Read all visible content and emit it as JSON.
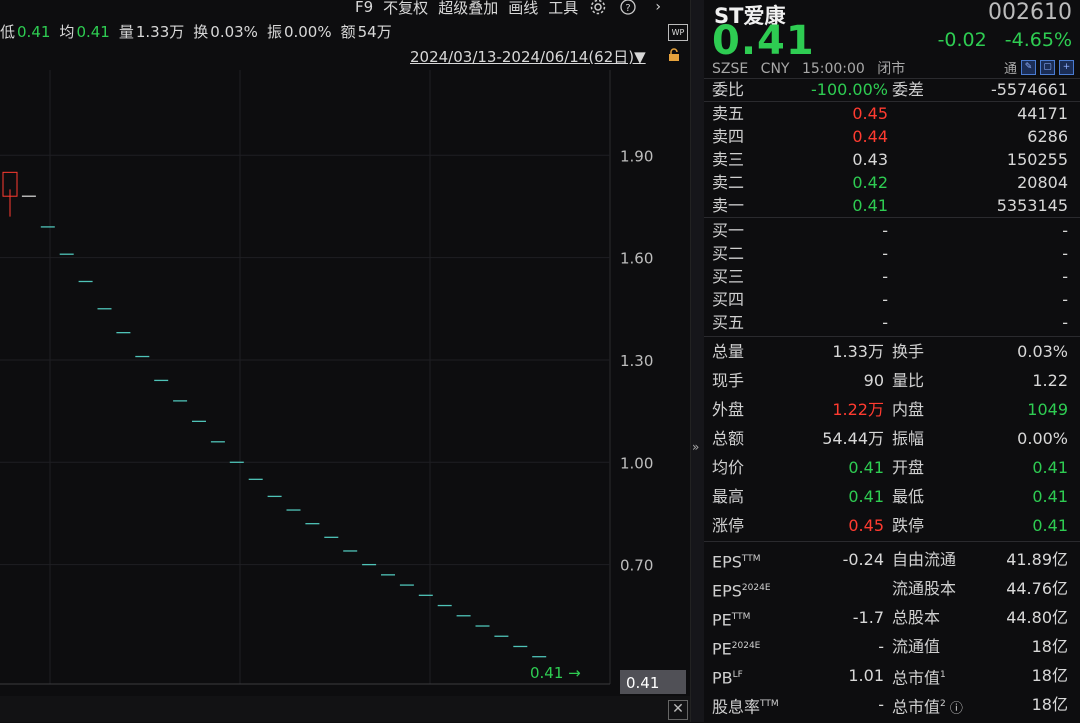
{
  "toolbar": {
    "items": [
      "F9",
      "不复权",
      "超级叠加",
      "画线",
      "工具"
    ],
    "settings_icon": "gear-icon",
    "help_icon": "help-icon",
    "next_icon": "chevron-right-icon"
  },
  "stats": [
    {
      "label": "低",
      "value": "0.41",
      "color": "green"
    },
    {
      "label": "均",
      "value": "0.41",
      "color": "green"
    },
    {
      "label": "量",
      "value": "1.33万",
      "color": "white"
    },
    {
      "label": "换",
      "value": "0.03%",
      "color": "white"
    },
    {
      "label": "振",
      "value": "0.00%",
      "color": "white"
    },
    {
      "label": "额",
      "value": "54万",
      "color": "white"
    }
  ],
  "date_range": "2024/03/13-2024/06/14(62日)▼",
  "wp_label": "WP",
  "chart_data": {
    "type": "candlestick",
    "y_ticks": [
      "1.90",
      "1.60",
      "1.30",
      "1.00",
      "0.70"
    ],
    "ylim": [
      0.35,
      2.15
    ],
    "last_price_label": "0.41",
    "last_price_axis_label": "0.41",
    "candles": [
      {
        "o": 1.85,
        "c": 1.78,
        "h": 1.8,
        "l": 1.72,
        "color": "red"
      },
      {
        "o": 1.78,
        "c": 1.78,
        "h": 1.78,
        "l": 1.78,
        "color": "white"
      },
      {
        "o": 1.69,
        "c": 1.69,
        "h": 1.69,
        "l": 1.69,
        "color": "green"
      },
      {
        "o": 1.61,
        "c": 1.61,
        "h": 1.61,
        "l": 1.61,
        "color": "green"
      },
      {
        "o": 1.53,
        "c": 1.53,
        "h": 1.53,
        "l": 1.53,
        "color": "green"
      },
      {
        "o": 1.45,
        "c": 1.45,
        "h": 1.45,
        "l": 1.45,
        "color": "green"
      },
      {
        "o": 1.38,
        "c": 1.38,
        "h": 1.38,
        "l": 1.38,
        "color": "green"
      },
      {
        "o": 1.31,
        "c": 1.31,
        "h": 1.31,
        "l": 1.31,
        "color": "green"
      },
      {
        "o": 1.24,
        "c": 1.24,
        "h": 1.24,
        "l": 1.24,
        "color": "green"
      },
      {
        "o": 1.18,
        "c": 1.18,
        "h": 1.18,
        "l": 1.18,
        "color": "green"
      },
      {
        "o": 1.12,
        "c": 1.12,
        "h": 1.12,
        "l": 1.12,
        "color": "green"
      },
      {
        "o": 1.06,
        "c": 1.06,
        "h": 1.06,
        "l": 1.06,
        "color": "green"
      },
      {
        "o": 1.0,
        "c": 1.0,
        "h": 1.0,
        "l": 1.0,
        "color": "green"
      },
      {
        "o": 0.95,
        "c": 0.95,
        "h": 0.95,
        "l": 0.95,
        "color": "green"
      },
      {
        "o": 0.9,
        "c": 0.9,
        "h": 0.9,
        "l": 0.9,
        "color": "green"
      },
      {
        "o": 0.86,
        "c": 0.86,
        "h": 0.86,
        "l": 0.86,
        "color": "green"
      },
      {
        "o": 0.82,
        "c": 0.82,
        "h": 0.82,
        "l": 0.82,
        "color": "green"
      },
      {
        "o": 0.78,
        "c": 0.78,
        "h": 0.78,
        "l": 0.78,
        "color": "green"
      },
      {
        "o": 0.74,
        "c": 0.74,
        "h": 0.74,
        "l": 0.74,
        "color": "green"
      },
      {
        "o": 0.7,
        "c": 0.7,
        "h": 0.7,
        "l": 0.7,
        "color": "green"
      },
      {
        "o": 0.67,
        "c": 0.67,
        "h": 0.67,
        "l": 0.67,
        "color": "green"
      },
      {
        "o": 0.64,
        "c": 0.64,
        "h": 0.64,
        "l": 0.64,
        "color": "green"
      },
      {
        "o": 0.61,
        "c": 0.61,
        "h": 0.61,
        "l": 0.61,
        "color": "green"
      },
      {
        "o": 0.58,
        "c": 0.58,
        "h": 0.58,
        "l": 0.58,
        "color": "green"
      },
      {
        "o": 0.55,
        "c": 0.55,
        "h": 0.55,
        "l": 0.55,
        "color": "green"
      },
      {
        "o": 0.52,
        "c": 0.52,
        "h": 0.52,
        "l": 0.52,
        "color": "green"
      },
      {
        "o": 0.49,
        "c": 0.49,
        "h": 0.49,
        "l": 0.49,
        "color": "green"
      },
      {
        "o": 0.46,
        "c": 0.46,
        "h": 0.46,
        "l": 0.46,
        "color": "green"
      },
      {
        "o": 0.43,
        "c": 0.43,
        "h": 0.43,
        "l": 0.43,
        "color": "green"
      }
    ]
  },
  "quote": {
    "name": "ST爱康",
    "code": "002610",
    "price": "0.41",
    "change": "-0.02",
    "change_pct": "-4.65%",
    "exchange": "SZSE",
    "currency": "CNY",
    "time": "15:00:00",
    "status": "闭市",
    "tool_label": "通"
  },
  "weibi": {
    "label1": "委比",
    "value1": "-100.00%",
    "label2": "委差",
    "value2": "-5574661"
  },
  "asks": [
    {
      "label": "卖五",
      "price": "0.45",
      "vol": "44171",
      "color": "red"
    },
    {
      "label": "卖四",
      "price": "0.44",
      "vol": "6286",
      "color": "red"
    },
    {
      "label": "卖三",
      "price": "0.43",
      "vol": "150255",
      "color": "white"
    },
    {
      "label": "卖二",
      "price": "0.42",
      "vol": "20804",
      "color": "green"
    },
    {
      "label": "卖一",
      "price": "0.41",
      "vol": "5353145",
      "color": "green"
    }
  ],
  "bids": [
    {
      "label": "买一",
      "price": "-",
      "vol": "-"
    },
    {
      "label": "买二",
      "price": "-",
      "vol": "-"
    },
    {
      "label": "买三",
      "price": "-",
      "vol": "-"
    },
    {
      "label": "买四",
      "price": "-",
      "vol": "-"
    },
    {
      "label": "买五",
      "price": "-",
      "vol": "-"
    }
  ],
  "stats_table": [
    {
      "l1": "总量",
      "v1": "1.33万",
      "c1": "white",
      "l2": "换手",
      "v2": "0.03%",
      "c2": "white"
    },
    {
      "l1": "现手",
      "v1": "90",
      "c1": "white",
      "l2": "量比",
      "v2": "1.22",
      "c2": "white"
    },
    {
      "l1": "外盘",
      "v1": "1.22万",
      "c1": "red",
      "l2": "内盘",
      "v2": "1049",
      "c2": "green"
    },
    {
      "l1": "总额",
      "v1": "54.44万",
      "c1": "white",
      "l2": "振幅",
      "v2": "0.00%",
      "c2": "white"
    },
    {
      "l1": "均价",
      "v1": "0.41",
      "c1": "green",
      "l2": "开盘",
      "v2": "0.41",
      "c2": "green"
    },
    {
      "l1": "最高",
      "v1": "0.41",
      "c1": "green",
      "l2": "最低",
      "v2": "0.41",
      "c2": "green"
    },
    {
      "l1": "涨停",
      "v1": "0.45",
      "c1": "red",
      "l2": "跌停",
      "v2": "0.41",
      "c2": "green"
    }
  ],
  "fundamentals": [
    {
      "l1": "EPS",
      "sup1": "TTM",
      "v1": "-0.24",
      "l2": "自由流通",
      "sup2": "",
      "v2": "41.89亿"
    },
    {
      "l1": "EPS",
      "sup1": "2024E",
      "v1": "",
      "l2": "流通股本",
      "sup2": "",
      "v2": "44.76亿"
    },
    {
      "l1": "PE",
      "sup1": "TTM",
      "v1": "-1.7",
      "l2": "总股本",
      "sup2": "",
      "v2": "44.80亿"
    },
    {
      "l1": "PE",
      "sup1": "2024E",
      "v1": "-",
      "l2": "流通值",
      "sup2": "",
      "v2": "18亿"
    },
    {
      "l1": "PB",
      "sup1": "LF",
      "v1": "1.01",
      "l2": "总市值",
      "sup2": "1",
      "v2": "18亿"
    },
    {
      "l1": "股息率",
      "sup1": "TTM",
      "v1": "-",
      "l2": "总市值",
      "sup2": "2",
      "v2": "18亿"
    }
  ]
}
